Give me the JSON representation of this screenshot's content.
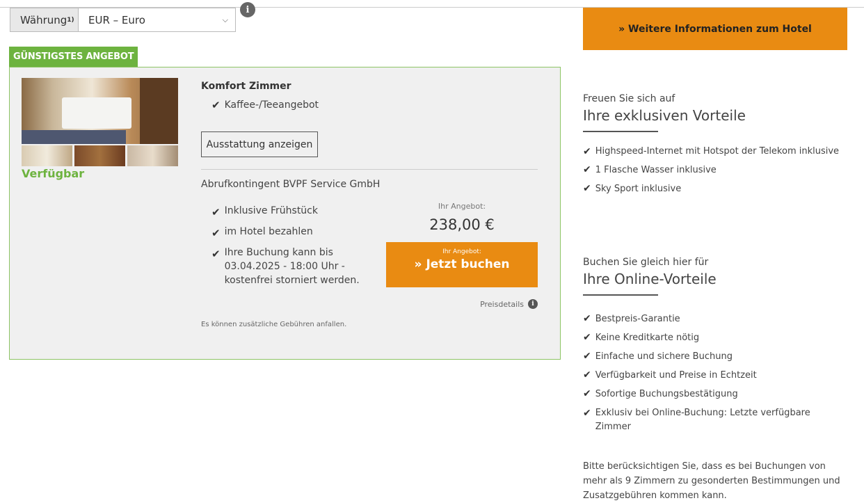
{
  "currency": {
    "label": "Währung",
    "footnote": "1)",
    "selected": "EUR – Euro",
    "info_glyph": "i"
  },
  "offer": {
    "tag": "GÜNSTIGSTES ANGEBOT",
    "availability": "Verfügbar",
    "room_title": "Komfort Zimmer",
    "room_feature": "Kaffee-/Teeangebot",
    "equipment_button": "Ausstattung anzeigen",
    "rate_name": "Abrufkontingent BVPF Service GmbH",
    "conditions": [
      "Inklusive Frühstück",
      "im Hotel bezahlen",
      "Ihre Buchung kann bis 03.04.2025 - 18:00 Uhr - kostenfrei storniert werden."
    ],
    "price_label": "Ihr Angebot:",
    "price": "238,00 €",
    "book_small": "Ihr Angebot:",
    "book_label": "» Jetzt buchen",
    "price_details": "Preisdetails",
    "fees_note": "Es können zusätzliche Gebühren anfallen."
  },
  "sidebar": {
    "more_info_button": "» Weitere Informationen zum Hotel",
    "exclusive": {
      "pre": "Freuen Sie sich auf",
      "heading": "Ihre exklusiven Vorteile",
      "items": [
        "Highspeed-Internet mit Hotspot der Telekom inklusive",
        "1 Flasche Wasser inklusive",
        "Sky Sport inklusive"
      ]
    },
    "online": {
      "pre": "Buchen Sie gleich hier für",
      "heading": "Ihre Online-Vorteile",
      "items": [
        "Bestpreis-Garantie",
        "Keine Kreditkarte nötig",
        "Einfache und sichere Buchung",
        "Verfügbarkeit und Preise in Echtzeit",
        "Sofortige Buchungsbestätigung",
        "Exklusiv bei Online-Buchung: Letzte verfügbare Zimmer"
      ]
    },
    "note": "Bitte berücksichtigen Sie, dass es bei Buchungen von mehr als 9 Zimmern zu gesonderten Bestimmungen und Zusatzgebühren kommen kann."
  },
  "colors": {
    "accent_orange": "#e98b12",
    "green": "#6db33f"
  }
}
